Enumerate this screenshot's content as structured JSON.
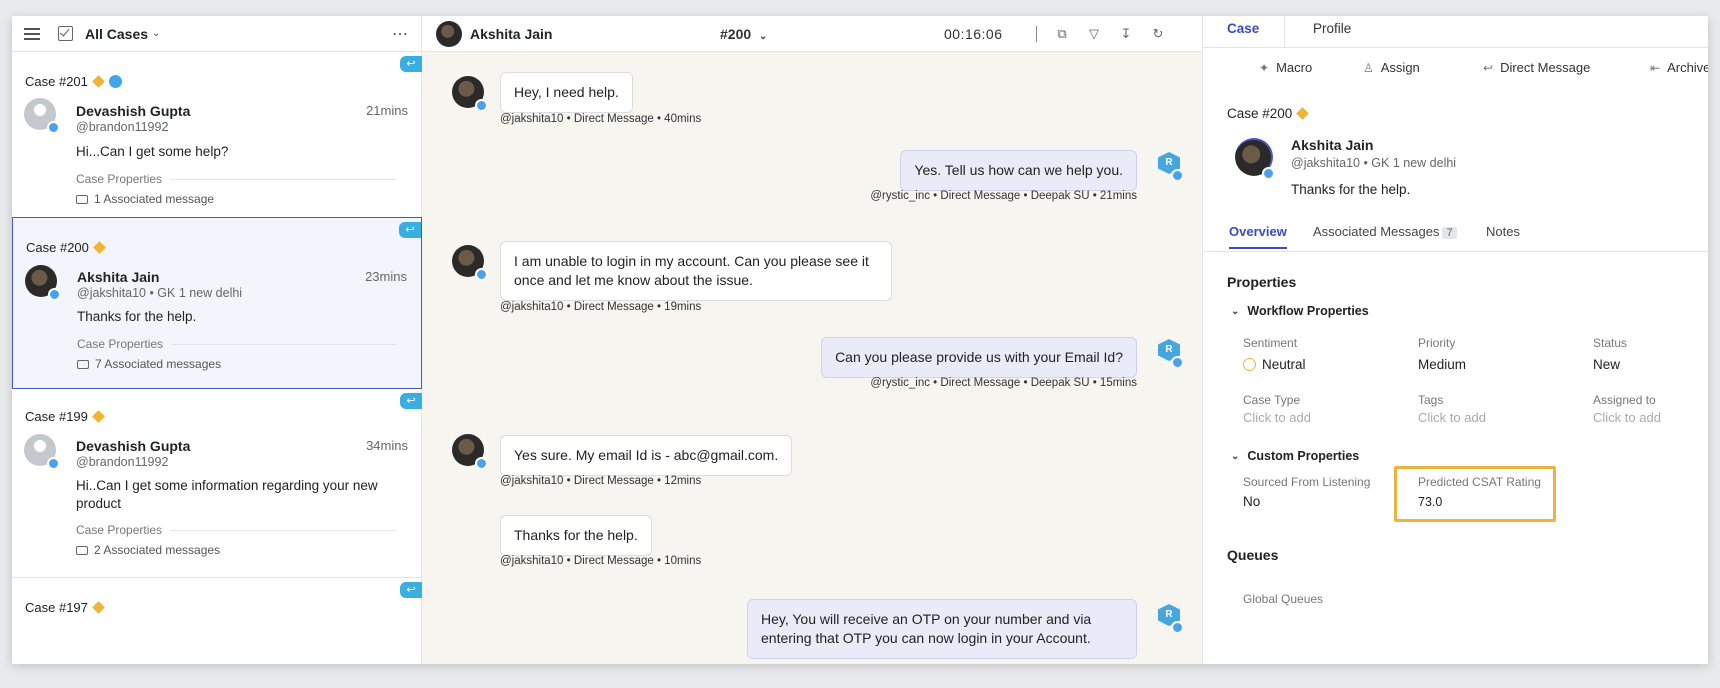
{
  "left": {
    "title": "All Cases",
    "cases": [
      {
        "case_no": "Case #201",
        "name": "Devashish Gupta",
        "time": "21mins",
        "handle": "@brandon11992",
        "message": "Hi...Can I get some help?",
        "props": "Case Properties",
        "assoc": "1 Associated message"
      },
      {
        "case_no": "Case #200",
        "name": "Akshita Jain",
        "time": "23mins",
        "handle": "@jakshita10 • GK 1 new delhi",
        "message": "Thanks for the help.",
        "props": "Case Properties",
        "assoc": "7 Associated messages"
      },
      {
        "case_no": "Case #199",
        "name": "Devashish Gupta",
        "time": "34mins",
        "handle": "@brandon11992",
        "message": "Hi..Can I get some information regarding your new product",
        "props": "Case Properties",
        "assoc": "2 Associated messages"
      },
      {
        "case_no": "Case #197"
      }
    ]
  },
  "middle": {
    "name": "Akshita Jain",
    "case": "#200",
    "timer": "00:16:06",
    "messages": [
      {
        "text": "Hey, I need help.",
        "meta": "@jakshita10 • Direct Message • 40mins"
      },
      {
        "text": "Yes. Tell us how can we help you.",
        "meta": "@rystic_inc • Direct Message • Deepak SU • 21mins"
      },
      {
        "text": "I am unable to login in my account. Can you please see it once and let me know about the issue.",
        "meta": "@jakshita10 • Direct Message • 19mins"
      },
      {
        "text": "Can you please provide us with your Email Id?",
        "meta": "@rystic_inc • Direct Message • Deepak SU • 15mins"
      },
      {
        "text": "Yes sure. My email Id is - abc@gmail.com.",
        "meta": "@jakshita10 • Direct Message • 12mins"
      },
      {
        "text": "Thanks for the help.",
        "meta": "@jakshita10 • Direct Message • 10mins"
      },
      {
        "text": "Hey, You will receive an OTP on your number and via entering that OTP you can now login in your Account."
      }
    ],
    "agent_initial": "R"
  },
  "right": {
    "tabs": [
      "Case",
      "Profile"
    ],
    "actions": [
      "Macro",
      "Assign",
      "Direct Message",
      "Archive"
    ],
    "case_no": "Case #200",
    "name": "Akshita Jain",
    "handle": "@jakshita10 • GK 1 new delhi",
    "text": "Thanks for the help.",
    "subtabs": {
      "overview": "Overview",
      "assoc": "Associated Messages",
      "assoc_count": "7",
      "notes": "Notes"
    },
    "properties_title": "Properties",
    "workflow_title": "Workflow Properties",
    "workflow": [
      {
        "label": "Sentiment",
        "value": "Neutral"
      },
      {
        "label": "Priority",
        "value": "Medium"
      },
      {
        "label": "Status",
        "value": "New"
      },
      {
        "label": "Case Type",
        "value": "Click to add"
      },
      {
        "label": "Tags",
        "value": "Click to add"
      },
      {
        "label": "Assigned to",
        "value": "Click to add"
      }
    ],
    "custom_title": "Custom Properties",
    "custom": [
      {
        "label": "Sourced From Listening",
        "value": "No"
      },
      {
        "label": "Predicted CSAT Rating",
        "value": "73.0"
      }
    ],
    "queues_title": "Queues",
    "global_queues": "Global Queues"
  },
  "colors": {
    "accent": "#3b4bc0",
    "highlight": "#f0b13f",
    "twitter": "#4aa3ea",
    "diamond": "#f2b233"
  }
}
